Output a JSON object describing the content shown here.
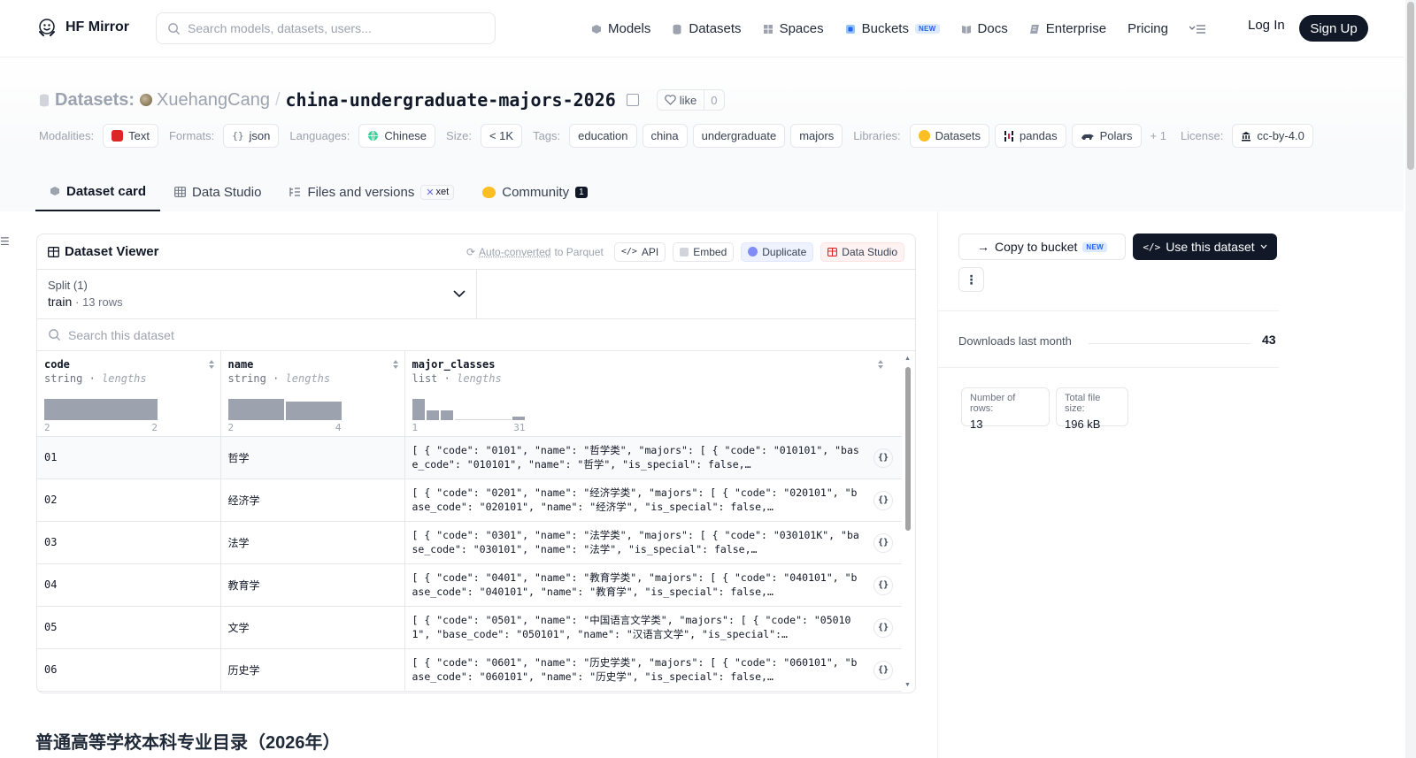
{
  "nav": {
    "brand": "HF Mirror",
    "search_placeholder": "Search models, datasets, users...",
    "links": [
      {
        "label": "Models",
        "icon": "cube-icon"
      },
      {
        "label": "Datasets",
        "icon": "database-icon"
      },
      {
        "label": "Spaces",
        "icon": "grid-icon"
      },
      {
        "label": "Buckets",
        "icon": "bucket-icon",
        "badge": "NEW"
      },
      {
        "label": "Docs",
        "icon": "book-icon"
      },
      {
        "label": "Enterprise",
        "icon": "enterprise-icon"
      },
      {
        "label": "Pricing"
      }
    ],
    "login": "Log In",
    "signup": "Sign Up"
  },
  "header": {
    "prefix": "Datasets:",
    "owner": "XuehangCang",
    "separator": "/",
    "name": "china-undergraduate-majors-2026",
    "like_label": "like",
    "like_count": "0"
  },
  "meta": {
    "modalities_label": "Modalities:",
    "modality": "Text",
    "formats_label": "Formats:",
    "format": "json",
    "languages_label": "Languages:",
    "language": "Chinese",
    "size_label": "Size:",
    "size": "< 1K",
    "tags_label": "Tags:",
    "tags": [
      "education",
      "china",
      "undergraduate",
      "majors"
    ],
    "libraries_label": "Libraries:",
    "libraries": [
      "Datasets",
      "pandas",
      "Polars"
    ],
    "libraries_more": "+ 1",
    "license_label": "License:",
    "license": "cc-by-4.0"
  },
  "tabs": [
    {
      "label": "Dataset card",
      "active": true
    },
    {
      "label": "Data Studio"
    },
    {
      "label": "Files and versions",
      "badge": "xet"
    },
    {
      "label": "Community",
      "count": "1"
    }
  ],
  "viewer": {
    "title": "Dataset Viewer",
    "auto_link": "Auto-converted",
    "auto_suffix": "to Parquet",
    "buttons": [
      "API",
      "Embed",
      "Duplicate",
      "Data Studio"
    ],
    "split_label": "Split (1)",
    "split_value": "train",
    "split_rows": "13 rows",
    "search_placeholder": "Search this dataset",
    "columns": [
      {
        "name": "code",
        "type": "string",
        "stat": "lengths",
        "min": "2",
        "max": "2"
      },
      {
        "name": "name",
        "type": "string",
        "stat": "lengths",
        "min": "2",
        "max": "4"
      },
      {
        "name": "major_classes",
        "type": "list",
        "stat": "lengths",
        "min": "1",
        "max": "31"
      }
    ],
    "rows": [
      {
        "code": "01",
        "name": "哲学",
        "major_classes": "[ { \"code\": \"0101\", \"name\": \"哲学类\", \"majors\": [ { \"code\": \"010101\", \"base_code\": \"010101\", \"name\": \"哲学\", \"is_special\": false,…"
      },
      {
        "code": "02",
        "name": "经济学",
        "major_classes": "[ { \"code\": \"0201\", \"name\": \"经济学类\", \"majors\": [ { \"code\": \"020101\", \"base_code\": \"020101\", \"name\": \"经济学\", \"is_special\": false,…"
      },
      {
        "code": "03",
        "name": "法学",
        "major_classes": "[ { \"code\": \"0301\", \"name\": \"法学类\", \"majors\": [ { \"code\": \"030101K\", \"base_code\": \"030101\", \"name\": \"法学\", \"is_special\": false,…"
      },
      {
        "code": "04",
        "name": "教育学",
        "major_classes": "[ { \"code\": \"0401\", \"name\": \"教育学类\", \"majors\": [ { \"code\": \"040101\", \"base_code\": \"040101\", \"name\": \"教育学\", \"is_special\": false,…"
      },
      {
        "code": "05",
        "name": "文学",
        "major_classes": "[ { \"code\": \"0501\", \"name\": \"中国语言文学类\", \"majors\": [ { \"code\": \"050101\", \"base_code\": \"050101\", \"name\": \"汉语言文学\", \"is_special\":…"
      },
      {
        "code": "06",
        "name": "历史学",
        "major_classes": "[ { \"code\": \"0601\", \"name\": \"历史学类\", \"majors\": [ { \"code\": \"060101\", \"base_code\": \"060101\", \"name\": \"历史学\", \"is_special\": false,…"
      }
    ]
  },
  "sidebar": {
    "copy_label": "Copy to bucket",
    "copy_badge": "NEW",
    "use_label": "Use this dataset",
    "downloads_label": "Downloads last month",
    "downloads_value": "43",
    "rows_label": "Number of rows:",
    "rows_value": "13",
    "size_label": "Total file size:",
    "size_value": "196 kB"
  },
  "card_title": "普通高等学校本科专业目录（2026年）",
  "colors": {
    "primary": "#111827",
    "muted": "#9ca3af",
    "border": "#e5e7eb",
    "new_badge": "#2563eb"
  }
}
